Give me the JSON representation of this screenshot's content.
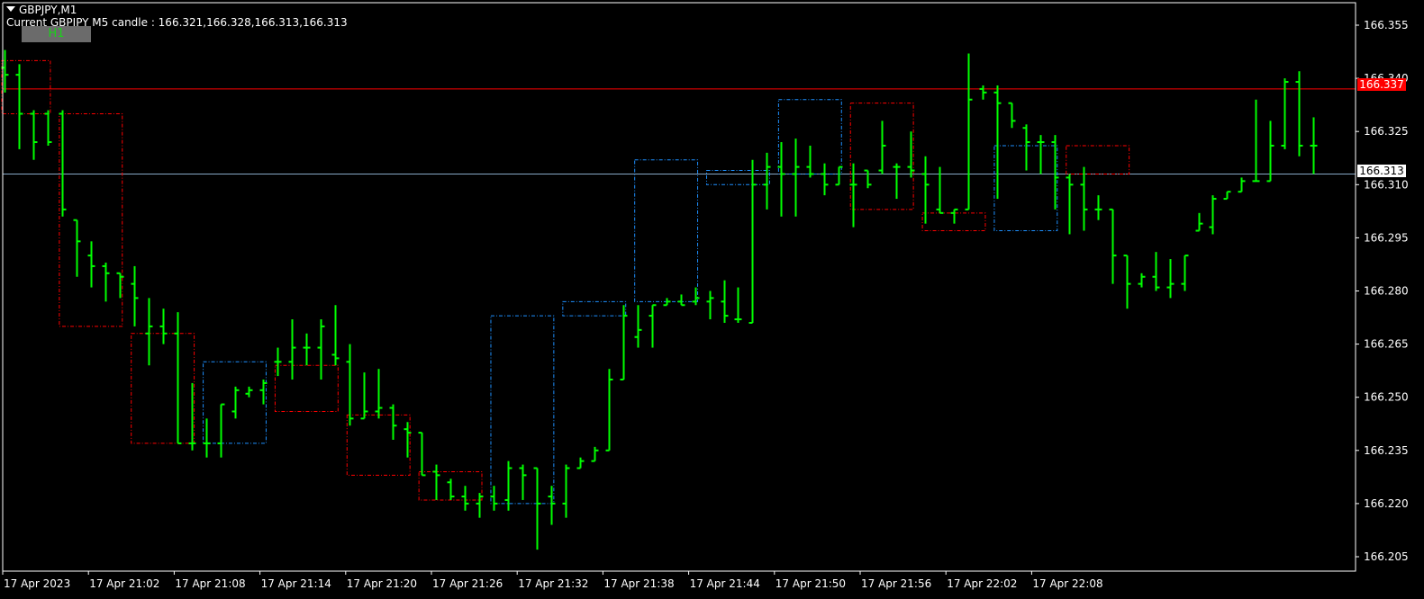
{
  "header": {
    "symbol": "GBPJPY,M1",
    "candle_info": "Current GBPJPY M5 candle : 166.321,166.328,166.313,166.313",
    "timeframe_button": "H1"
  },
  "price_tags": {
    "red_line": "166.337",
    "current": "166.313"
  },
  "colors": {
    "background": "#000000",
    "axis": "#ffffff",
    "bar": "#00ff00",
    "bear_box": "#ff0000",
    "bull_box": "#1e90ff",
    "red_line": "#ff0000",
    "current_line": "#87a9c7"
  },
  "chart_data": {
    "type": "ohlc",
    "symbol": "GBPJPY",
    "timeframe": "M1",
    "y_ticks": [
      "166.355",
      "166.340",
      "166.325",
      "166.310",
      "166.295",
      "166.280",
      "166.265",
      "166.250",
      "166.235",
      "166.220",
      "166.205"
    ],
    "y_range": [
      166.202,
      166.357
    ],
    "x_ticks": [
      "17 Apr 2023",
      "17 Apr 21:02",
      "17 Apr 21:08",
      "17 Apr 21:14",
      "17 Apr 21:20",
      "17 Apr 21:26",
      "17 Apr 21:32",
      "17 Apr 21:38",
      "17 Apr 21:44",
      "17 Apr 21:50",
      "17 Apr 21:56",
      "17 Apr 22:02",
      "17 Apr 22:08"
    ],
    "horizontal_lines": [
      {
        "price": 166.337,
        "color": "red"
      },
      {
        "price": 166.313,
        "color": "current"
      }
    ],
    "m5_boxes": [
      {
        "start": 0,
        "end": 3,
        "high": 166.345,
        "low": 166.33,
        "dir": "bear"
      },
      {
        "start": 4,
        "end": 8,
        "high": 166.33,
        "low": 166.27,
        "dir": "bear"
      },
      {
        "start": 9,
        "end": 13,
        "high": 166.268,
        "low": 166.237,
        "dir": "bear"
      },
      {
        "start": 14,
        "end": 18,
        "high": 166.26,
        "low": 166.237,
        "dir": "bull"
      },
      {
        "start": 19,
        "end": 23,
        "high": 166.259,
        "low": 166.246,
        "dir": "bear"
      },
      {
        "start": 24,
        "end": 28,
        "high": 166.245,
        "low": 166.228,
        "dir": "bear"
      },
      {
        "start": 29,
        "end": 33,
        "high": 166.229,
        "low": 166.221,
        "dir": "bear"
      },
      {
        "start": 34,
        "end": 38,
        "high": 166.273,
        "low": 166.22,
        "dir": "bull"
      },
      {
        "start": 39,
        "end": 43,
        "high": 166.277,
        "low": 166.273,
        "dir": "bull"
      },
      {
        "start": 44,
        "end": 48,
        "high": 166.317,
        "low": 166.277,
        "dir": "bull"
      },
      {
        "start": 49,
        "end": 53,
        "high": 166.314,
        "low": 166.31,
        "dir": "bull"
      },
      {
        "start": 54,
        "end": 58,
        "high": 166.334,
        "low": 166.313,
        "dir": "bull"
      },
      {
        "start": 59,
        "end": 63,
        "high": 166.333,
        "low": 166.303,
        "dir": "bear"
      },
      {
        "start": 64,
        "end": 68,
        "high": 166.302,
        "low": 166.297,
        "dir": "bear"
      },
      {
        "start": 69,
        "end": 73,
        "high": 166.321,
        "low": 166.297,
        "dir": "bull"
      },
      {
        "start": 74,
        "end": 78,
        "high": 166.321,
        "low": 166.313,
        "dir": "bear"
      }
    ],
    "bars": [
      {
        "o": 166.343,
        "h": 166.348,
        "l": 166.336,
        "c": 166.341
      },
      {
        "o": 166.341,
        "h": 166.344,
        "l": 166.32,
        "c": 166.33
      },
      {
        "o": 166.33,
        "h": 166.331,
        "l": 166.317,
        "c": 166.322
      },
      {
        "o": 166.33,
        "h": 166.331,
        "l": 166.321,
        "c": 166.322
      },
      {
        "o": 166.33,
        "h": 166.331,
        "l": 166.301,
        "c": 166.303
      },
      {
        "o": 166.3,
        "h": 166.296,
        "l": 166.284,
        "c": 166.294
      },
      {
        "o": 166.29,
        "h": 166.294,
        "l": 166.281,
        "c": 166.287
      },
      {
        "o": 166.287,
        "h": 166.288,
        "l": 166.277,
        "c": 166.285
      },
      {
        "o": 166.285,
        "h": 166.285,
        "l": 166.278,
        "c": 166.284
      },
      {
        "o": 166.282,
        "h": 166.287,
        "l": 166.27,
        "c": 166.278
      },
      {
        "o": 166.268,
        "h": 166.278,
        "l": 166.259,
        "c": 166.27
      },
      {
        "o": 166.27,
        "h": 166.275,
        "l": 166.265,
        "c": 166.268
      },
      {
        "o": 166.268,
        "h": 166.274,
        "l": 166.237,
        "c": 166.237
      },
      {
        "o": 166.237,
        "h": 166.254,
        "l": 166.235,
        "c": 166.237
      },
      {
        "o": 166.237,
        "h": 166.244,
        "l": 166.233,
        "c": 166.237
      },
      {
        "o": 166.237,
        "h": 166.248,
        "l": 166.233,
        "c": 166.248
      },
      {
        "o": 166.246,
        "h": 166.253,
        "l": 166.244,
        "c": 166.252
      },
      {
        "o": 166.251,
        "h": 166.253,
        "l": 166.25,
        "c": 166.252
      },
      {
        "o": 166.252,
        "h": 166.255,
        "l": 166.248,
        "c": 166.254
      },
      {
        "o": 166.26,
        "h": 166.264,
        "l": 166.256,
        "c": 166.26
      },
      {
        "o": 166.26,
        "h": 166.272,
        "l": 166.255,
        "c": 166.264
      },
      {
        "o": 166.264,
        "h": 166.268,
        "l": 166.259,
        "c": 166.264
      },
      {
        "o": 166.264,
        "h": 166.272,
        "l": 166.255,
        "c": 166.27
      },
      {
        "o": 166.262,
        "h": 166.276,
        "l": 166.259,
        "c": 166.261
      },
      {
        "o": 166.26,
        "h": 166.265,
        "l": 166.242,
        "c": 166.244
      },
      {
        "o": 166.244,
        "h": 166.257,
        "l": 166.245,
        "c": 166.246
      },
      {
        "o": 166.246,
        "h": 166.258,
        "l": 166.244,
        "c": 166.247
      },
      {
        "o": 166.247,
        "h": 166.248,
        "l": 166.238,
        "c": 166.242
      },
      {
        "o": 166.241,
        "h": 166.243,
        "l": 166.233,
        "c": 166.24
      },
      {
        "o": 166.24,
        "h": 166.24,
        "l": 166.232,
        "c": 166.228
      },
      {
        "o": 166.229,
        "h": 166.231,
        "l": 166.221,
        "c": 166.228
      },
      {
        "o": 166.226,
        "h": 166.227,
        "l": 166.221,
        "c": 166.222
      },
      {
        "o": 166.222,
        "h": 166.225,
        "l": 166.218,
        "c": 166.22
      },
      {
        "o": 166.22,
        "h": 166.223,
        "l": 166.216,
        "c": 166.222
      },
      {
        "o": 166.222,
        "h": 166.225,
        "l": 166.218,
        "c": 166.22
      },
      {
        "o": 166.221,
        "h": 166.232,
        "l": 166.218,
        "c": 166.23
      },
      {
        "o": 166.23,
        "h": 166.231,
        "l": 166.221,
        "c": 166.228
      },
      {
        "o": 166.23,
        "h": 166.225,
        "l": 166.207,
        "c": 166.22
      },
      {
        "o": 166.222,
        "h": 166.225,
        "l": 166.214,
        "c": 166.22
      },
      {
        "o": 166.22,
        "h": 166.231,
        "l": 166.216,
        "c": 166.23
      },
      {
        "o": 166.23,
        "h": 166.233,
        "l": 166.231,
        "c": 166.232
      },
      {
        "o": 166.232,
        "h": 166.236,
        "l": 166.233,
        "c": 166.235
      },
      {
        "o": 166.235,
        "h": 166.258,
        "l": 166.235,
        "c": 166.255
      },
      {
        "o": 166.255,
        "h": 166.276,
        "l": 166.256,
        "c": 166.273
      },
      {
        "o": 166.267,
        "h": 166.276,
        "l": 166.264,
        "c": 166.269
      },
      {
        "o": 166.273,
        "h": 166.276,
        "l": 166.264,
        "c": 166.276
      },
      {
        "o": 166.276,
        "h": 166.278,
        "l": 166.277,
        "c": 166.277
      },
      {
        "o": 166.277,
        "h": 166.279,
        "l": 166.276,
        "c": 166.276
      },
      {
        "o": 166.277,
        "h": 166.281,
        "l": 166.276,
        "c": 166.278
      },
      {
        "o": 166.277,
        "h": 166.28,
        "l": 166.272,
        "c": 166.278
      },
      {
        "o": 166.277,
        "h": 166.283,
        "l": 166.271,
        "c": 166.273
      },
      {
        "o": 166.272,
        "h": 166.281,
        "l": 166.271,
        "c": 166.272
      },
      {
        "o": 166.271,
        "h": 166.317,
        "l": 166.271,
        "c": 166.31
      },
      {
        "o": 166.31,
        "h": 166.319,
        "l": 166.303,
        "c": 166.315
      },
      {
        "o": 166.315,
        "h": 166.322,
        "l": 166.301,
        "c": 166.313
      },
      {
        "o": 166.313,
        "h": 166.323,
        "l": 166.301,
        "c": 166.315
      },
      {
        "o": 166.315,
        "h": 166.321,
        "l": 166.312,
        "c": 166.313
      },
      {
        "o": 166.313,
        "h": 166.316,
        "l": 166.307,
        "c": 166.31
      },
      {
        "o": 166.31,
        "h": 166.315,
        "l": 166.31,
        "c": 166.315
      },
      {
        "o": 166.31,
        "h": 166.316,
        "l": 166.298,
        "c": 166.31
      },
      {
        "o": 166.314,
        "h": 166.314,
        "l": 166.309,
        "c": 166.31
      },
      {
        "o": 166.314,
        "h": 166.328,
        "l": 166.313,
        "c": 166.321
      },
      {
        "o": 166.315,
        "h": 166.316,
        "l": 166.306,
        "c": 166.315
      },
      {
        "o": 166.315,
        "h": 166.325,
        "l": 166.312,
        "c": 166.314
      },
      {
        "o": 166.313,
        "h": 166.318,
        "l": 166.299,
        "c": 166.31
      },
      {
        "o": 166.303,
        "h": 166.315,
        "l": 166.302,
        "c": 166.302
      },
      {
        "o": 166.302,
        "h": 166.297,
        "l": 166.299,
        "c": 166.303
      },
      {
        "o": 166.303,
        "h": 166.347,
        "l": 166.306,
        "c": 166.334
      },
      {
        "o": 166.337,
        "h": 166.338,
        "l": 166.334,
        "c": 166.336
      },
      {
        "o": 166.336,
        "h": 166.338,
        "l": 166.306,
        "c": 166.333
      },
      {
        "o": 166.333,
        "h": 166.333,
        "l": 166.326,
        "c": 166.328
      },
      {
        "o": 166.326,
        "h": 166.327,
        "l": 166.314,
        "c": 166.322
      },
      {
        "o": 166.322,
        "h": 166.324,
        "l": 166.313,
        "c": 166.322
      },
      {
        "o": 166.322,
        "h": 166.324,
        "l": 166.303,
        "c": 166.312
      },
      {
        "o": 166.312,
        "h": 166.313,
        "l": 166.296,
        "c": 166.31
      },
      {
        "o": 166.31,
        "h": 166.315,
        "l": 166.297,
        "c": 166.303
      },
      {
        "o": 166.303,
        "h": 166.307,
        "l": 166.3,
        "c": 166.303
      },
      {
        "o": 166.303,
        "h": 166.302,
        "l": 166.282,
        "c": 166.29
      },
      {
        "o": 166.29,
        "h": 166.284,
        "l": 166.275,
        "c": 166.282
      },
      {
        "o": 166.282,
        "h": 166.285,
        "l": 166.281,
        "c": 166.284
      },
      {
        "o": 166.284,
        "h": 166.291,
        "l": 166.28,
        "c": 166.281
      },
      {
        "o": 166.281,
        "h": 166.289,
        "l": 166.278,
        "c": 166.282
      },
      {
        "o": 166.282,
        "h": 166.29,
        "l": 166.28,
        "c": 166.29
      },
      {
        "o": 166.297,
        "h": 166.302,
        "l": 166.297,
        "c": 166.299
      },
      {
        "o": 166.298,
        "h": 166.307,
        "l": 166.296,
        "c": 166.306
      },
      {
        "o": 166.306,
        "h": 166.308,
        "l": 166.306,
        "c": 166.308
      },
      {
        "o": 166.308,
        "h": 166.312,
        "l": 166.309,
        "c": 166.311
      },
      {
        "o": 166.311,
        "h": 166.334,
        "l": 166.311,
        "c": 166.311
      },
      {
        "o": 166.311,
        "h": 166.328,
        "l": 166.318,
        "c": 166.321
      },
      {
        "o": 166.321,
        "h": 166.34,
        "l": 166.32,
        "c": 166.339
      },
      {
        "o": 166.339,
        "h": 166.342,
        "l": 166.318,
        "c": 166.321
      },
      {
        "o": 166.321,
        "h": 166.329,
        "l": 166.313,
        "c": 166.321
      }
    ]
  }
}
